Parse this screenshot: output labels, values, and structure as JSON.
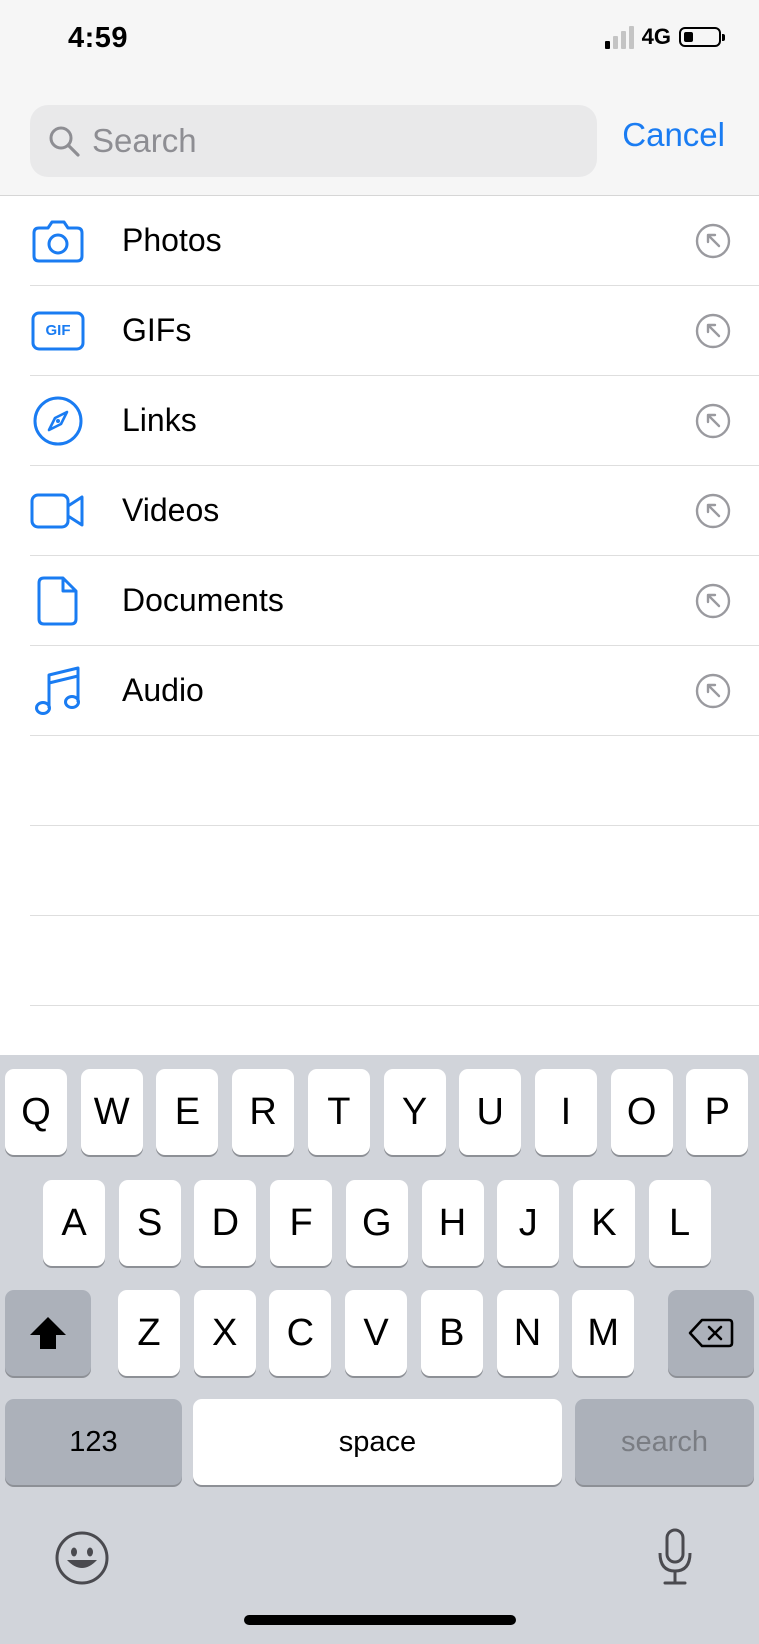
{
  "status_bar": {
    "time": "4:59",
    "network": "4G",
    "signal_bars_on": 1,
    "signal_bars_total": 4,
    "battery_level": 0.25
  },
  "search": {
    "placeholder": "Search",
    "value": "",
    "cancel_label": "Cancel"
  },
  "categories": [
    {
      "label": "Photos",
      "icon": "camera-icon"
    },
    {
      "label": "GIFs",
      "icon": "gif-icon",
      "icon_text": "GIF"
    },
    {
      "label": "Links",
      "icon": "compass-icon"
    },
    {
      "label": "Videos",
      "icon": "video-camera-icon"
    },
    {
      "label": "Documents",
      "icon": "document-icon"
    },
    {
      "label": "Audio",
      "icon": "music-note-icon"
    }
  ],
  "keyboard": {
    "row1": [
      "Q",
      "W",
      "E",
      "R",
      "T",
      "Y",
      "U",
      "I",
      "O",
      "P"
    ],
    "row2": [
      "A",
      "S",
      "D",
      "F",
      "G",
      "H",
      "J",
      "K",
      "L"
    ],
    "row3": [
      "Z",
      "X",
      "C",
      "V",
      "B",
      "N",
      "M"
    ],
    "numbers_label": "123",
    "space_label": "space",
    "search_label": "search"
  },
  "colors": {
    "accent": "#1a7cf2",
    "keyboard_bg": "#d1d4da",
    "key_dark": "#acb1ba"
  }
}
